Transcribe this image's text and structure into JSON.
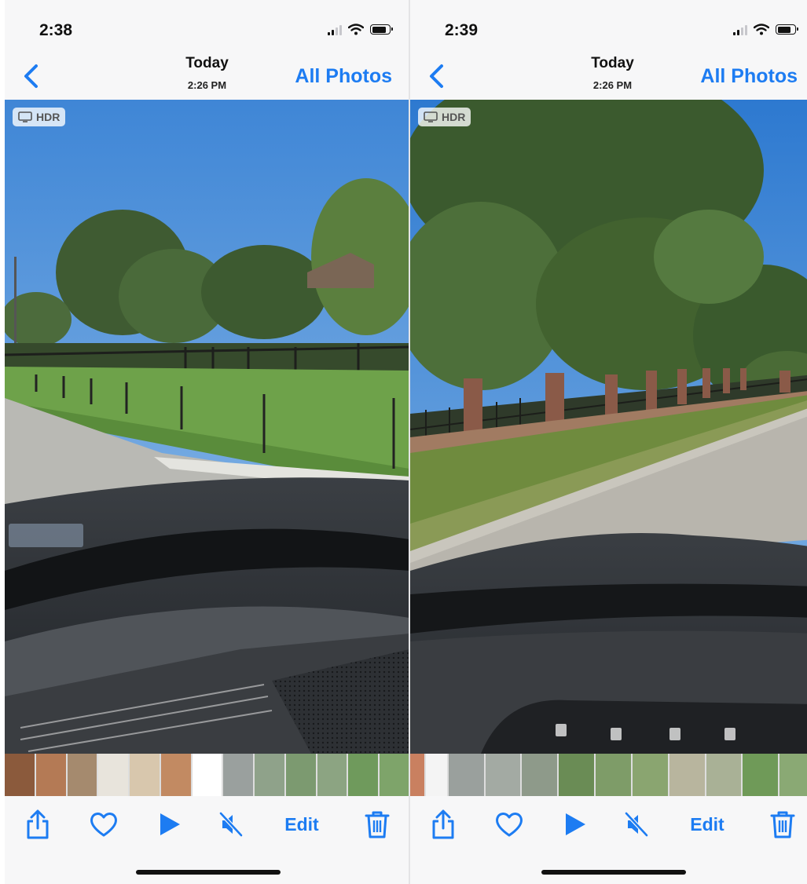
{
  "screens": [
    {
      "status": {
        "time": "2:38",
        "icons": [
          "cellular-signal-icon",
          "wifi-icon",
          "battery-icon"
        ]
      },
      "nav": {
        "back_icon": "chevron-left-icon",
        "title": "Today",
        "subtitle": "2:26 PM",
        "right_label": "All Photos"
      },
      "photo": {
        "badge": "HDR",
        "badge_icon": "display-icon",
        "scene": "view through windshield: sky, trees, fence, lawn, dashboard"
      },
      "toolbar": {
        "icons": [
          "share-icon",
          "heart-icon",
          "play-icon",
          "speaker-muted-icon",
          "trash-icon"
        ],
        "edit_label": "Edit"
      }
    },
    {
      "status": {
        "time": "2:39",
        "icons": [
          "cellular-signal-icon",
          "wifi-icon",
          "battery-icon"
        ]
      },
      "nav": {
        "back_icon": "chevron-left-icon",
        "title": "Today",
        "subtitle": "2:26 PM",
        "right_label": "All Photos"
      },
      "photo": {
        "badge": "HDR",
        "badge_icon": "display-icon",
        "scene": "view through windshield: large oak trees, brick-post fence, road, dashboard"
      },
      "toolbar": {
        "icons": [
          "share-icon",
          "heart-icon",
          "play-icon",
          "speaker-muted-icon",
          "trash-icon"
        ],
        "edit_label": "Edit"
      }
    }
  ],
  "colors": {
    "accent": "#1d7cf2",
    "background": "#f7f7f8",
    "text": "#111111"
  }
}
